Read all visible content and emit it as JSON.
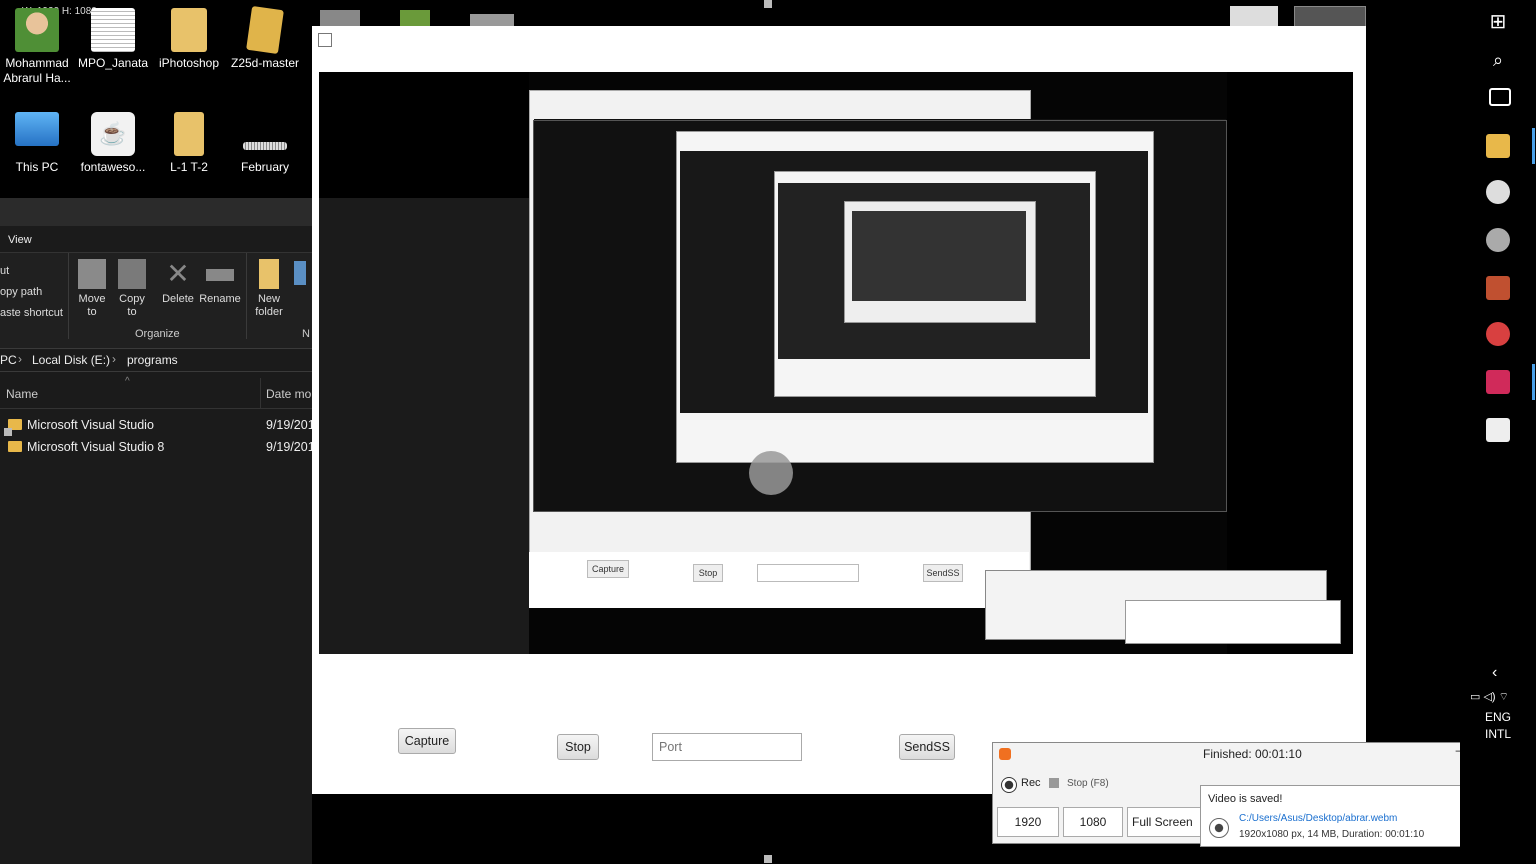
{
  "desktop": {
    "size_label": "W: 1920 H: 1080",
    "icons": [
      {
        "label": "Mohammad Abrarul Ha...",
        "icon": "user-icon",
        "color": "#5a8f3a"
      },
      {
        "label": "MPO_Janata",
        "icon": "document-icon",
        "color": "#e8e8e8"
      },
      {
        "label": "iPhotoshop",
        "icon": "folder-icon",
        "color": "#e8c26a"
      },
      {
        "label": "Z25d-master",
        "icon": "folder-icon",
        "color": "#e0b44a"
      },
      {
        "label": "This PC",
        "icon": "computer-icon",
        "color": "#3a8fd8"
      },
      {
        "label": "fontaweso...",
        "icon": "java-icon",
        "color": "#f2f2f2"
      },
      {
        "label": "L-1 T-2",
        "icon": "folder-icon",
        "color": "#e8c26a"
      },
      {
        "label": "February",
        "icon": "file-icon",
        "color": "#cfcfcf"
      }
    ]
  },
  "explorer": {
    "tab_view": "View",
    "clipboard": [
      "ut",
      "opy path",
      "aste shortcut"
    ],
    "buttons": {
      "move_to": "Move to",
      "copy_to": "Copy to",
      "delete": "Delete",
      "rename": "Rename",
      "new_folder": "New folder"
    },
    "group_organize": "Organize",
    "group_new": "N",
    "breadcrumb": [
      "PC",
      "Local Disk (E:)",
      "programs"
    ],
    "columns": {
      "name": "Name",
      "date": "Date mo"
    },
    "rows": [
      {
        "name": "Microsoft Visual Studio",
        "date": "9/19/201"
      },
      {
        "name": "Microsoft Visual Studio 8",
        "date": "9/19/201"
      }
    ]
  },
  "app": {
    "capture_label": "Capture",
    "stop_label": "Stop",
    "port_placeholder": "Port",
    "sendss_label": "SendSS"
  },
  "recorder": {
    "status": "Finished:  00:01:10",
    "rec_label": "Rec",
    "stop_label": "Stop (F8)",
    "width": "1920",
    "height": "1080",
    "mode": "Full Screen",
    "popup_title": "Video is saved!",
    "popup_path": "C:/Users/Asus/Desktop/abrar.webm",
    "popup_info": "1920x1080 px, 14 MB, Duration:  00:01:10"
  },
  "taskbar": {
    "lang": "ENG",
    "layout": "INTL",
    "icons": [
      "windows-icon",
      "search-icon",
      "task-view-icon",
      "file-explorer-icon",
      "clock-app-icon",
      "chrome-icon",
      "office-icon",
      "snipping-icon",
      "intellij-icon",
      "java-icon"
    ]
  }
}
